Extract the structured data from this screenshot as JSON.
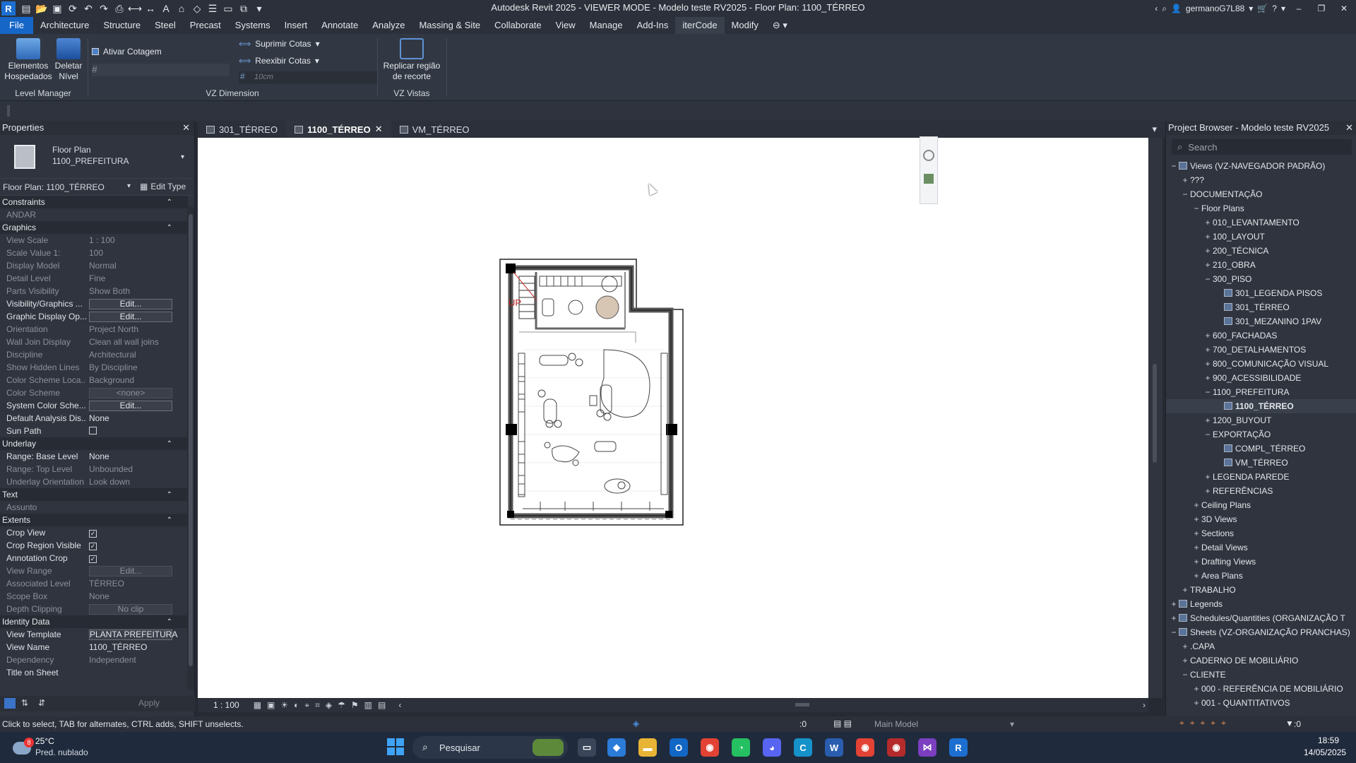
{
  "app": {
    "title": "Autodesk Revit 2025 - VIEWER MODE - Modelo teste RV2025 - Floor Plan: 1100_TÉRREO",
    "user": "germanoG7L88"
  },
  "menu": [
    "File",
    "Architecture",
    "Structure",
    "Steel",
    "Precast",
    "Systems",
    "Insert",
    "Annotate",
    "Analyze",
    "Massing & Site",
    "Collaborate",
    "View",
    "Manage",
    "Add-Ins",
    "iterCode",
    "Modify"
  ],
  "ribbon": {
    "level_manager": {
      "title": "Level Manager",
      "btn1": "Elementos Hospedados",
      "btn2": "Deletar Nível"
    },
    "vz_dimension": {
      "title": "VZ Dimension",
      "ativar": "Ativar Cotagem",
      "suprimir": "Suprimir Cotas",
      "reexibir": "Reexibir Cotas",
      "placeholder": "10cm"
    },
    "vz_vistas": {
      "title": "VZ Vistas",
      "replicar": "Replicar região de recorte"
    }
  },
  "properties": {
    "header": "Properties",
    "type_family": "Floor Plan",
    "type_name": "1100_PREFEITURA",
    "instance_selector": "Floor Plan: 1100_TÉRREO",
    "edit_type": "Edit Type",
    "groups": {
      "constraints": "Constraints",
      "graphics": "Graphics",
      "underlay": "Underlay",
      "text": "Text",
      "extents": "Extents",
      "identity": "Identity Data"
    },
    "rows": {
      "andar": {
        "k": "ANDAR",
        "v": ""
      },
      "view_scale": {
        "k": "View Scale",
        "v": "1 : 100"
      },
      "scale_value": {
        "k": "Scale Value    1:",
        "v": "100"
      },
      "display_model": {
        "k": "Display Model",
        "v": "Normal"
      },
      "detail_level": {
        "k": "Detail Level",
        "v": "Fine"
      },
      "parts_visibility": {
        "k": "Parts Visibility",
        "v": "Show Both"
      },
      "vis_graphics": {
        "k": "Visibility/Graphics ...",
        "v": "Edit..."
      },
      "graphic_display": {
        "k": "Graphic Display Op...",
        "v": "Edit..."
      },
      "orientation": {
        "k": "Orientation",
        "v": "Project North"
      },
      "wall_join": {
        "k": "Wall Join Display",
        "v": "Clean all wall joins"
      },
      "discipline": {
        "k": "Discipline",
        "v": "Architectural"
      },
      "hidden_lines": {
        "k": "Show Hidden Lines",
        "v": "By Discipline"
      },
      "color_scheme_loc": {
        "k": "Color Scheme Loca...",
        "v": "Background"
      },
      "color_scheme": {
        "k": "Color Scheme",
        "v": "<none>"
      },
      "system_color": {
        "k": "System Color Sche...",
        "v": "Edit..."
      },
      "default_analysis": {
        "k": "Default Analysis Dis...",
        "v": "None"
      },
      "sun_path": {
        "k": "Sun Path",
        "v": ""
      },
      "base_level": {
        "k": "Range: Base Level",
        "v": "None"
      },
      "top_level": {
        "k": "Range: Top Level",
        "v": "Unbounded"
      },
      "underlay_orient": {
        "k": "Underlay Orientation",
        "v": "Look down"
      },
      "assunto": {
        "k": "Assunto",
        "v": ""
      },
      "crop_view": {
        "k": "Crop View",
        "v": "✓"
      },
      "crop_region": {
        "k": "Crop Region Visible",
        "v": "✓"
      },
      "annotation_crop": {
        "k": "Annotation Crop",
        "v": "✓"
      },
      "view_range": {
        "k": "View Range",
        "v": "Edit..."
      },
      "assoc_level": {
        "k": "Associated Level",
        "v": "TÉRREO"
      },
      "scope_box": {
        "k": "Scope Box",
        "v": "None"
      },
      "depth_clipping": {
        "k": "Depth Clipping",
        "v": "No clip"
      },
      "view_template": {
        "k": "View Template",
        "v": "PLANTA PREFEITURA"
      },
      "view_name": {
        "k": "View Name",
        "v": "1100_TÉRREO"
      },
      "dependency": {
        "k": "Dependency",
        "v": "Independent"
      },
      "title_on_sheet": {
        "k": "Title on Sheet",
        "v": ""
      }
    },
    "apply": "Apply"
  },
  "view_tabs": [
    {
      "label": "301_TÉRREO"
    },
    {
      "label": "1100_TÉRREO"
    },
    {
      "label": "VM_TÉRREO"
    }
  ],
  "view_control": {
    "scale": "1 : 100"
  },
  "plan": {
    "up_label": "UP"
  },
  "browser": {
    "title": "Project Browser - Modelo teste RV2025",
    "search_placeholder": "Search",
    "nodes": [
      {
        "label": "Views (VZ-NAVEGADOR PADRÃO)",
        "depth": 0,
        "tog": "−"
      },
      {
        "label": "???",
        "depth": 1,
        "tog": "+"
      },
      {
        "label": "DOCUMENTAÇÃO",
        "depth": 1,
        "tog": "−"
      },
      {
        "label": "Floor Plans",
        "depth": 2,
        "tog": "−"
      },
      {
        "label": "010_LEVANTAMENTO",
        "depth": 3,
        "tog": "+"
      },
      {
        "label": "100_LAYOUT",
        "depth": 3,
        "tog": "+"
      },
      {
        "label": "200_TÉCNICA",
        "depth": 3,
        "tog": "+"
      },
      {
        "label": "210_OBRA",
        "depth": 3,
        "tog": "+"
      },
      {
        "label": "300_PISO",
        "depth": 3,
        "tog": "−"
      },
      {
        "label": "301_LEGENDA PISOS",
        "depth": 4,
        "tog": ""
      },
      {
        "label": "301_TÉRREO",
        "depth": 4,
        "tog": ""
      },
      {
        "label": "301_MEZANINO 1PAV",
        "depth": 4,
        "tog": ""
      },
      {
        "label": "600_FACHADAS",
        "depth": 3,
        "tog": "+"
      },
      {
        "label": "700_DETALHAMENTOS",
        "depth": 3,
        "tog": "+"
      },
      {
        "label": "800_COMUNICAÇÃO VISUAL",
        "depth": 3,
        "tog": "+"
      },
      {
        "label": "900_ACESSIBILIDADE",
        "depth": 3,
        "tog": "+"
      },
      {
        "label": "1100_PREFEITURA",
        "depth": 3,
        "tog": "−"
      },
      {
        "label": "1100_TÉRREO",
        "depth": 4,
        "tog": ""
      },
      {
        "label": "1200_BUYOUT",
        "depth": 3,
        "tog": "+"
      },
      {
        "label": "EXPORTAÇÃO",
        "depth": 3,
        "tog": "−"
      },
      {
        "label": "COMPL_TÉRREO",
        "depth": 4,
        "tog": ""
      },
      {
        "label": "VM_TÉRREO",
        "depth": 4,
        "tog": ""
      },
      {
        "label": "LEGENDA PAREDE",
        "depth": 3,
        "tog": "+"
      },
      {
        "label": "REFERÊNCIAS",
        "depth": 3,
        "tog": "+"
      },
      {
        "label": "Ceiling Plans",
        "depth": 2,
        "tog": "+"
      },
      {
        "label": "3D Views",
        "depth": 2,
        "tog": "+"
      },
      {
        "label": "Sections",
        "depth": 2,
        "tog": "+"
      },
      {
        "label": "Detail Views",
        "depth": 2,
        "tog": "+"
      },
      {
        "label": "Drafting Views",
        "depth": 2,
        "tog": "+"
      },
      {
        "label": "Area Plans",
        "depth": 2,
        "tog": "+"
      },
      {
        "label": "TRABALHO",
        "depth": 1,
        "tog": "+"
      },
      {
        "label": "Legends",
        "depth": 0,
        "tog": "+"
      },
      {
        "label": "Schedules/Quantities (ORGANIZAÇÃO T",
        "depth": 0,
        "tog": "+"
      },
      {
        "label": "Sheets (VZ-ORGANIZAÇÃO PRANCHAS)",
        "depth": 0,
        "tog": "−"
      },
      {
        "label": ".CAPA",
        "depth": 1,
        "tog": "+"
      },
      {
        "label": "CADERNO DE MOBILIÁRIO",
        "depth": 1,
        "tog": "+"
      },
      {
        "label": "CLIENTE",
        "depth": 1,
        "tog": "−"
      },
      {
        "label": "000 - REFERÊNCIA DE MOBILIÁRIO",
        "depth": 2,
        "tog": "+"
      },
      {
        "label": "001 - QUANTITATIVOS",
        "depth": 2,
        "tog": "+"
      }
    ]
  },
  "status": {
    "hint": "Click to select, TAB for alternates, CTRL adds, SHIFT unselects.",
    "count": ":0",
    "model": "Main Model",
    "filter_count": ":0"
  },
  "taskbar": {
    "weather_temp": "25°C",
    "weather_desc": "Pred. nublado",
    "search": "Pesquisar",
    "time": "18:59",
    "date": "14/05/2025",
    "badge": "8"
  }
}
